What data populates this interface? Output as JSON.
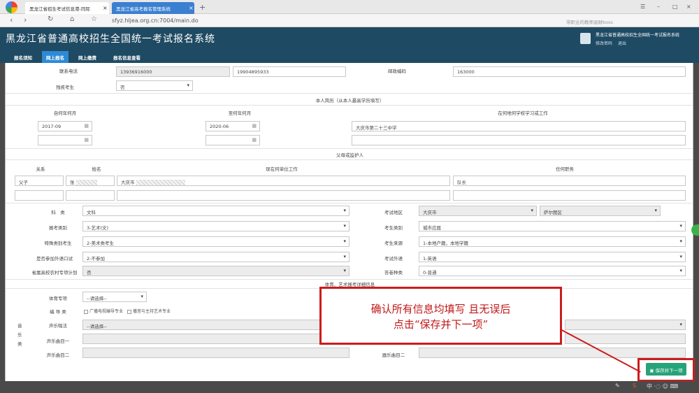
{
  "browser": {
    "tabs": [
      {
        "title": "黑龙江省招生考试信息港-同际",
        "close": "×"
      },
      {
        "title": "黑龙江省高考报名管理系统",
        "close": "×"
      }
    ],
    "new_tab": "+",
    "window_controls": {
      "pin": "☰",
      "minimize": "–",
      "maximize": "□",
      "close": "×"
    },
    "nav": {
      "back": "‹",
      "forward": "›",
      "reload": "↻",
      "home": "⌂",
      "star": "☆"
    },
    "url": "sfyz.hljea.org.cn:7004/main.do",
    "search_placeholder": "带职业的教师退财boss"
  },
  "header": {
    "system_name": "黑龙江省普通高校招生全国统一考试报名系统",
    "user_title": "黑龙江省普通高校招生全国统一考试报名系统",
    "change_password": "修改密码",
    "logout": "退出"
  },
  "nav_tabs": [
    {
      "label": "报名须知",
      "active": false
    },
    {
      "label": "网上报名",
      "active": true
    },
    {
      "label": "网上缴费",
      "active": false
    },
    {
      "label": "报名信息查看",
      "active": false
    }
  ],
  "form": {
    "contact": {
      "label": "联系电话",
      "phone1": "13936916000",
      "phone2": "19904895933",
      "postal_label": "邮政编码",
      "postal_value": "163000"
    },
    "disabled": {
      "label": "残疾考生",
      "value": "否"
    },
    "resume": {
      "title": "本人简历（从本人最高学历填写）",
      "col_from": "自何年何月",
      "col_to": "至何年何月",
      "col_school": "在何地何学校学习或工作",
      "rows": [
        {
          "from": "2017-09",
          "to": "2020-06",
          "school": "大庆市第二十三中学"
        },
        {
          "from": "",
          "to": "",
          "school": ""
        }
      ]
    },
    "guardian": {
      "title": "父母或监护人",
      "col_relation": "关系",
      "col_name": "姓名",
      "col_work": "现在何单位工作",
      "col_job": "任何职务",
      "rows": [
        {
          "relation": "父子",
          "name": "张",
          "work": "大庆市",
          "job": "队长"
        },
        {
          "relation": "",
          "name": "",
          "work": "",
          "job": ""
        }
      ]
    },
    "fields": {
      "subject": {
        "label": "科　类",
        "value": "文科"
      },
      "exam_area": {
        "label": "考试地区",
        "city": "大庆市",
        "district": "萨尔图区"
      },
      "category": {
        "label": "报考类别",
        "value": "3-艺术(文)"
      },
      "student_type": {
        "label": "考生类别",
        "value": "城市应届"
      },
      "special": {
        "label": "特殊类别考生",
        "value": "2-美术类考生"
      },
      "source": {
        "label": "考生来源",
        "value": "1-本地户籍，本地学籍"
      },
      "oral": {
        "label": "是否参加外语口试",
        "value": "2-不参加"
      },
      "foreign_lang": {
        "label": "考试外语",
        "value": "1-英语"
      },
      "rural": {
        "label": "省属高校农村专项计划",
        "value": "否"
      },
      "exam_kind": {
        "label": "答卷种类",
        "value": "0-普通"
      }
    },
    "arts": {
      "title": "体育、艺术报考详细信息",
      "sports_label": "体育专项",
      "sports_value": "--请选择--",
      "director_label": "编 导 类",
      "director_options": [
        "广播电视编导专业",
        "播音与主持艺术专业"
      ],
      "music_label": "音乐类",
      "vocal_method_label": "声乐唱法",
      "vocal_method_value": "--请选择--",
      "vocal1_label": "声乐曲目一",
      "vocal2_label": "声乐曲目二",
      "instrument2_label": "器乐曲目二"
    }
  },
  "callout": {
    "line1": "确认所有信息均填写 且无误后",
    "line2": "点击“保存并下一项”"
  },
  "save_button": "保存并下一项"
}
